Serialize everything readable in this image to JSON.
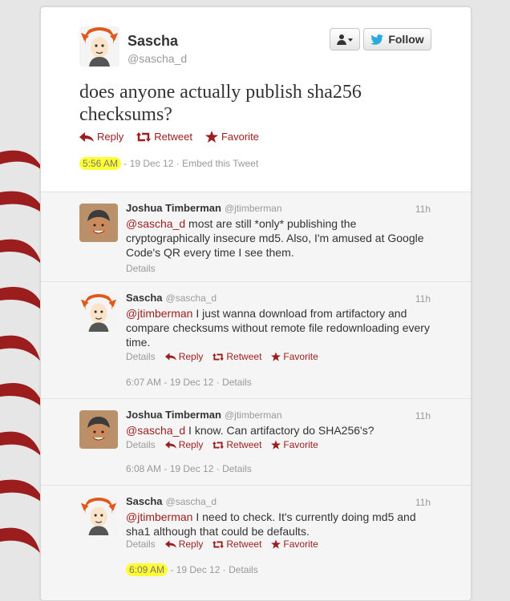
{
  "colors": {
    "accent": "#9b1d1d",
    "highlight": "#ffff33",
    "follow_bird": "#2aa9e0"
  },
  "main": {
    "name": "Sascha",
    "handle": "@sascha_d",
    "follow_label": "Follow",
    "text": "does anyone actually publish sha256 checksums?",
    "actions": {
      "reply": "Reply",
      "retweet": "Retweet",
      "favorite": "Favorite"
    },
    "time": "5:56 AM",
    "date_sep": "- 19 Dec 12",
    "dot": "·",
    "embed": "Embed this Tweet"
  },
  "replies": [
    {
      "name": "Joshua Timberman",
      "handle": "@jtimberman",
      "age": "11h",
      "mention": "@sascha_d",
      "text": " most are still *only* publishing the cryptographically insecure md5. Also, I'm amused at Google Code's QR every time I see them.",
      "details": "Details"
    },
    {
      "name": "Sascha",
      "handle": "@sascha_d",
      "age": "11h",
      "mention": "@jtimberman",
      "text": " I just wanna download from artifactory and compare checksums without remote file redownloading every time.",
      "details": "Details",
      "actions": {
        "reply": "Reply",
        "retweet": "Retweet",
        "favorite": "Favorite"
      },
      "timestamp": "6:07 AM - 19 Dec 12",
      "dot": "·",
      "meta_details": "Details"
    },
    {
      "name": "Joshua Timberman",
      "handle": "@jtimberman",
      "age": "11h",
      "mention": "@sascha_d",
      "text": " I know. Can artifactory do SHA256's?",
      "details": "Details",
      "actions": {
        "reply": "Reply",
        "retweet": "Retweet",
        "favorite": "Favorite"
      },
      "timestamp": "6:08 AM - 19 Dec 12",
      "dot": "·",
      "meta_details": "Details"
    },
    {
      "name": "Sascha",
      "handle": "@sascha_d",
      "age": "11h",
      "mention": "@jtimberman",
      "text": " I need to check. It's currently doing md5 and sha1 although that could be defaults.",
      "details": "Details",
      "actions": {
        "reply": "Reply",
        "retweet": "Retweet",
        "favorite": "Favorite"
      },
      "time": "6:09 AM",
      "date_sep": "- 19 Dec 12",
      "dot": "·",
      "meta_details": "Details"
    }
  ]
}
